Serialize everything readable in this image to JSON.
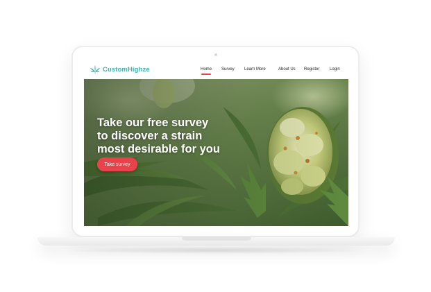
{
  "brand": {
    "name": "CustomHighze",
    "icon": "cannabis-leaf-icon",
    "color": "#3fb3b0"
  },
  "nav": {
    "items": [
      {
        "label": "Home",
        "active": true
      },
      {
        "label": "Survey",
        "active": false
      },
      {
        "label": "Learn More",
        "active": false
      },
      {
        "label": "About Us",
        "active": false
      },
      {
        "label": "Register",
        "active": false
      },
      {
        "label": "Login",
        "active": false
      }
    ],
    "active_color": "#e8434a"
  },
  "hero": {
    "title_lines": [
      "Take our free survey",
      "to discover a strain",
      "most desirable for you"
    ],
    "cta_label": "Take survey",
    "cta_color": "#e8434a",
    "background": "cannabis-plant-photo"
  }
}
